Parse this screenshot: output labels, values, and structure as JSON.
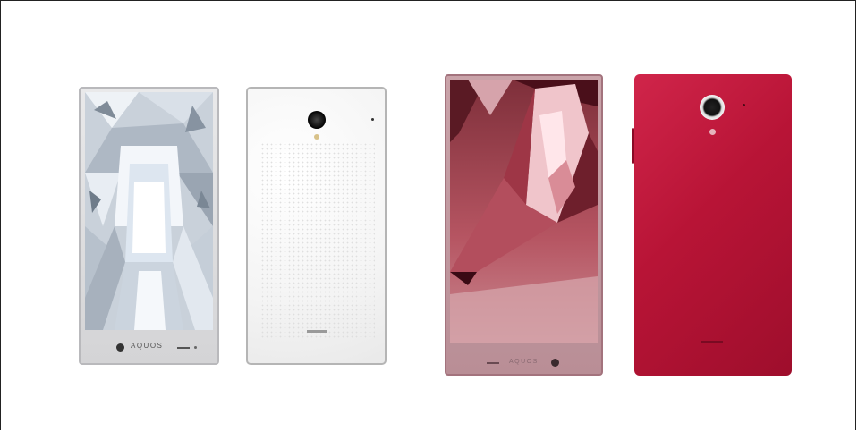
{
  "phones": [
    {
      "view": "front",
      "color": "silver",
      "brand": "AQUOS"
    },
    {
      "view": "back",
      "color": "white"
    },
    {
      "view": "front",
      "color": "red",
      "brand": "AQUOS"
    },
    {
      "view": "back",
      "color": "red"
    }
  ],
  "colors": {
    "silver": "#d4d4d6",
    "white": "#f4f4f4",
    "red_front_frame": "#b98e96",
    "red_back": "#b81436"
  }
}
